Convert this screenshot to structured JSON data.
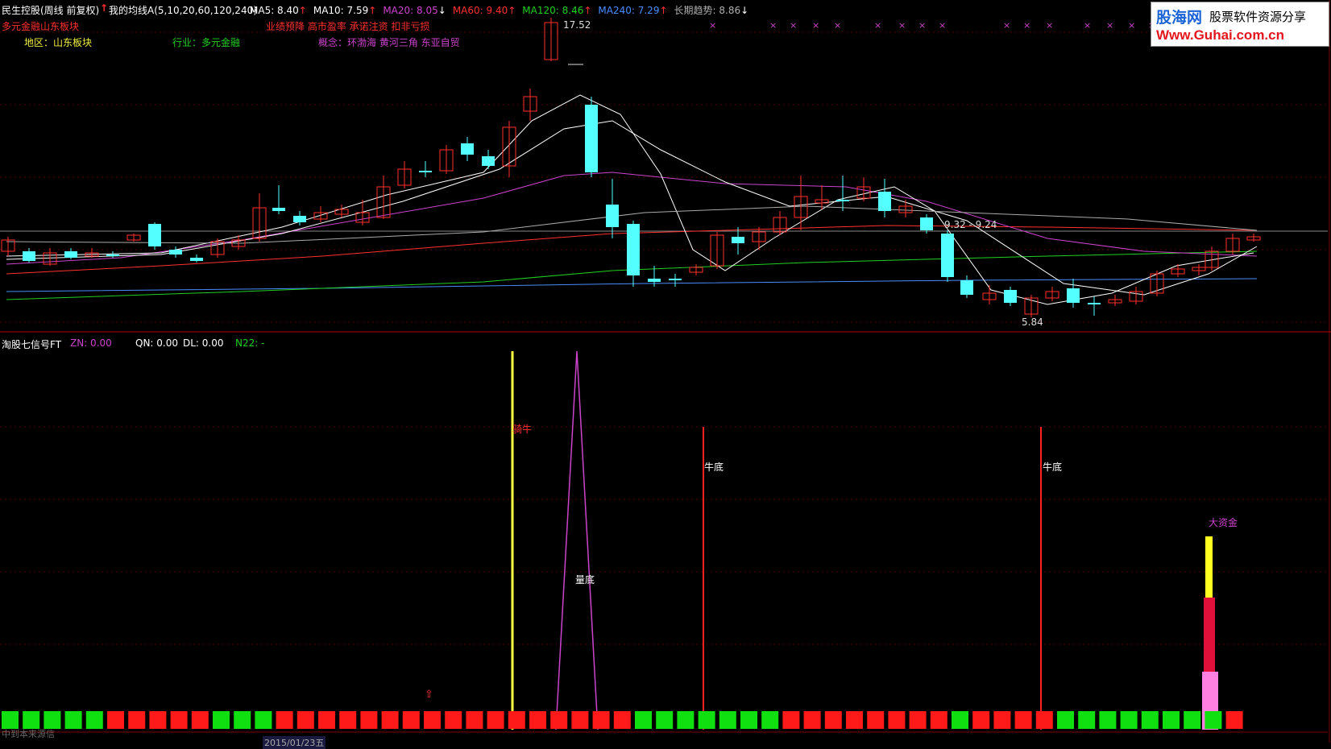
{
  "header": {
    "stock_title": "民生控股(周线 前复权)",
    "indicator_name": "我的均线A(5,10,20,60,120,240)",
    "ma_items": [
      {
        "label": "MA5: 8.40",
        "arrow": "↑",
        "color": "#ffffff",
        "arrow_color": "#ff3030"
      },
      {
        "label": "MA10: 7.59",
        "arrow": "↑",
        "color": "#ffffff",
        "arrow_color": "#ff3030"
      },
      {
        "label": "MA20: 8.05",
        "arrow": "↓",
        "color": "#cc44cc",
        "arrow_color": "#ffffff"
      },
      {
        "label": "MA60: 9.40",
        "arrow": "↑",
        "color": "#ff3030",
        "arrow_color": "#ff3030"
      },
      {
        "label": "MA120: 8.46",
        "arrow": "↑",
        "color": "#20d020",
        "arrow_color": "#ff3030"
      },
      {
        "label": "MA240: 7.29",
        "arrow": "↑",
        "color": "#4a8cff",
        "arrow_color": "#ff3030"
      },
      {
        "label": "长期趋势: 8.86",
        "arrow": "↓",
        "color": "#b0b0b0",
        "arrow_color": "#ffffff"
      }
    ],
    "info_row1_left": "多元金融山东板块",
    "info_row1_mid": "业绩预降 高市盈率 承诺注资 扣非亏损",
    "info_row2_region": "地区：山东板块",
    "info_row2_industry": "行业：多元金融",
    "info_row2_concept": "概念：环渤海 黄河三角 东亚自贸"
  },
  "logo": {
    "line1_brand": "股海网",
    "line1_tail": "股票软件资源分享",
    "line2": "Www.Guhai.com.cn"
  },
  "price_labels": {
    "high": "17.52",
    "low": "5.84",
    "mid": "9.32 - 9.24"
  },
  "lower_panel": {
    "title": "淘股七信号FT",
    "zn": "ZN: 0.00",
    "qn": "QN: 0.00",
    "dl": "DL: 0.00",
    "n22": "N22: -",
    "signal_qiniu": "骑牛",
    "signal_liangdi": "量底",
    "signal_niudi_1": "牛底",
    "signal_niudi_2": "牛底",
    "signal_dazijin": "大资金",
    "bottom_left_text": "中到本来源信",
    "date_label": "2015/01/23五"
  },
  "colors": {
    "up": "#ff3030",
    "down": "#54ffff",
    "ma5": "#ffffff",
    "ma10": "#ffff00",
    "ma20": "#cc44cc",
    "ma60": "#ff3030",
    "ma120": "#20d020",
    "ma240": "#4a8cff",
    "trend": "#c8c8c8",
    "grid": "#800000"
  }
}
